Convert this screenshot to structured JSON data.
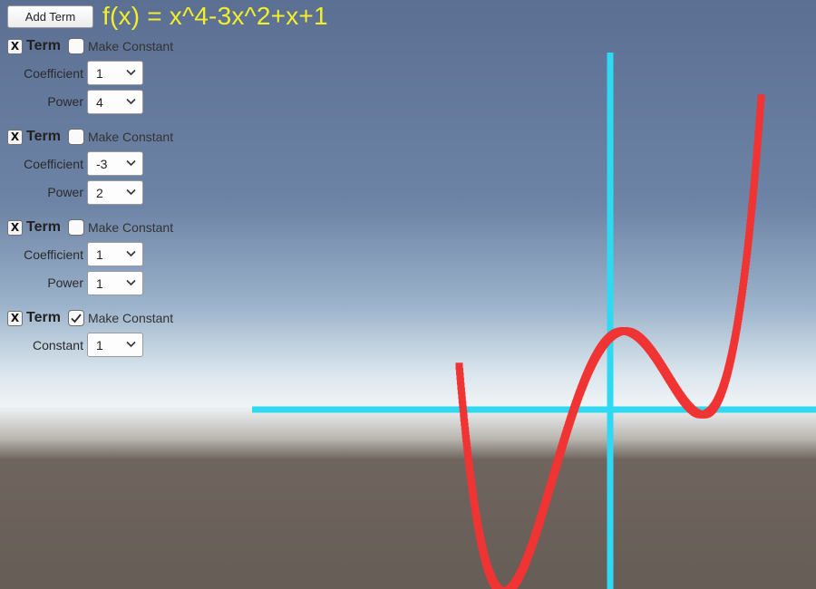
{
  "toolbar": {
    "add_term_label": "Add Term"
  },
  "formula": "f(x) = x^4-3x^2+x+1",
  "term_title": "Term",
  "remove_glyph": "X",
  "make_constant_label": "Make Constant",
  "terms": [
    {
      "remove": "X",
      "title": "Term",
      "make_constant": false,
      "coefficient_label": "Coefficient",
      "coefficient": "1",
      "power_label": "Power",
      "power": "4"
    },
    {
      "remove": "X",
      "title": "Term",
      "make_constant": false,
      "coefficient_label": "Coefficient",
      "coefficient": "-3",
      "power_label": "Power",
      "power": "2"
    },
    {
      "remove": "X",
      "title": "Term",
      "make_constant": false,
      "coefficient_label": "Coefficient",
      "coefficient": "1",
      "power_label": "Power",
      "power": "1"
    },
    {
      "remove": "X",
      "title": "Term",
      "make_constant": true,
      "constant_label": "Constant",
      "constant": "1"
    }
  ],
  "colors": {
    "curve": "#f03434",
    "axes": "#2fd9f2",
    "formula_text": "#f2ef2a",
    "sky_top": "#5b6f93",
    "horizon": "#eef2f4",
    "ground": "#6b625b"
  },
  "icons": {
    "remove": "close-x-icon",
    "checkbox": "checkbox-icon",
    "dropdown": "chevron-down-icon"
  }
}
